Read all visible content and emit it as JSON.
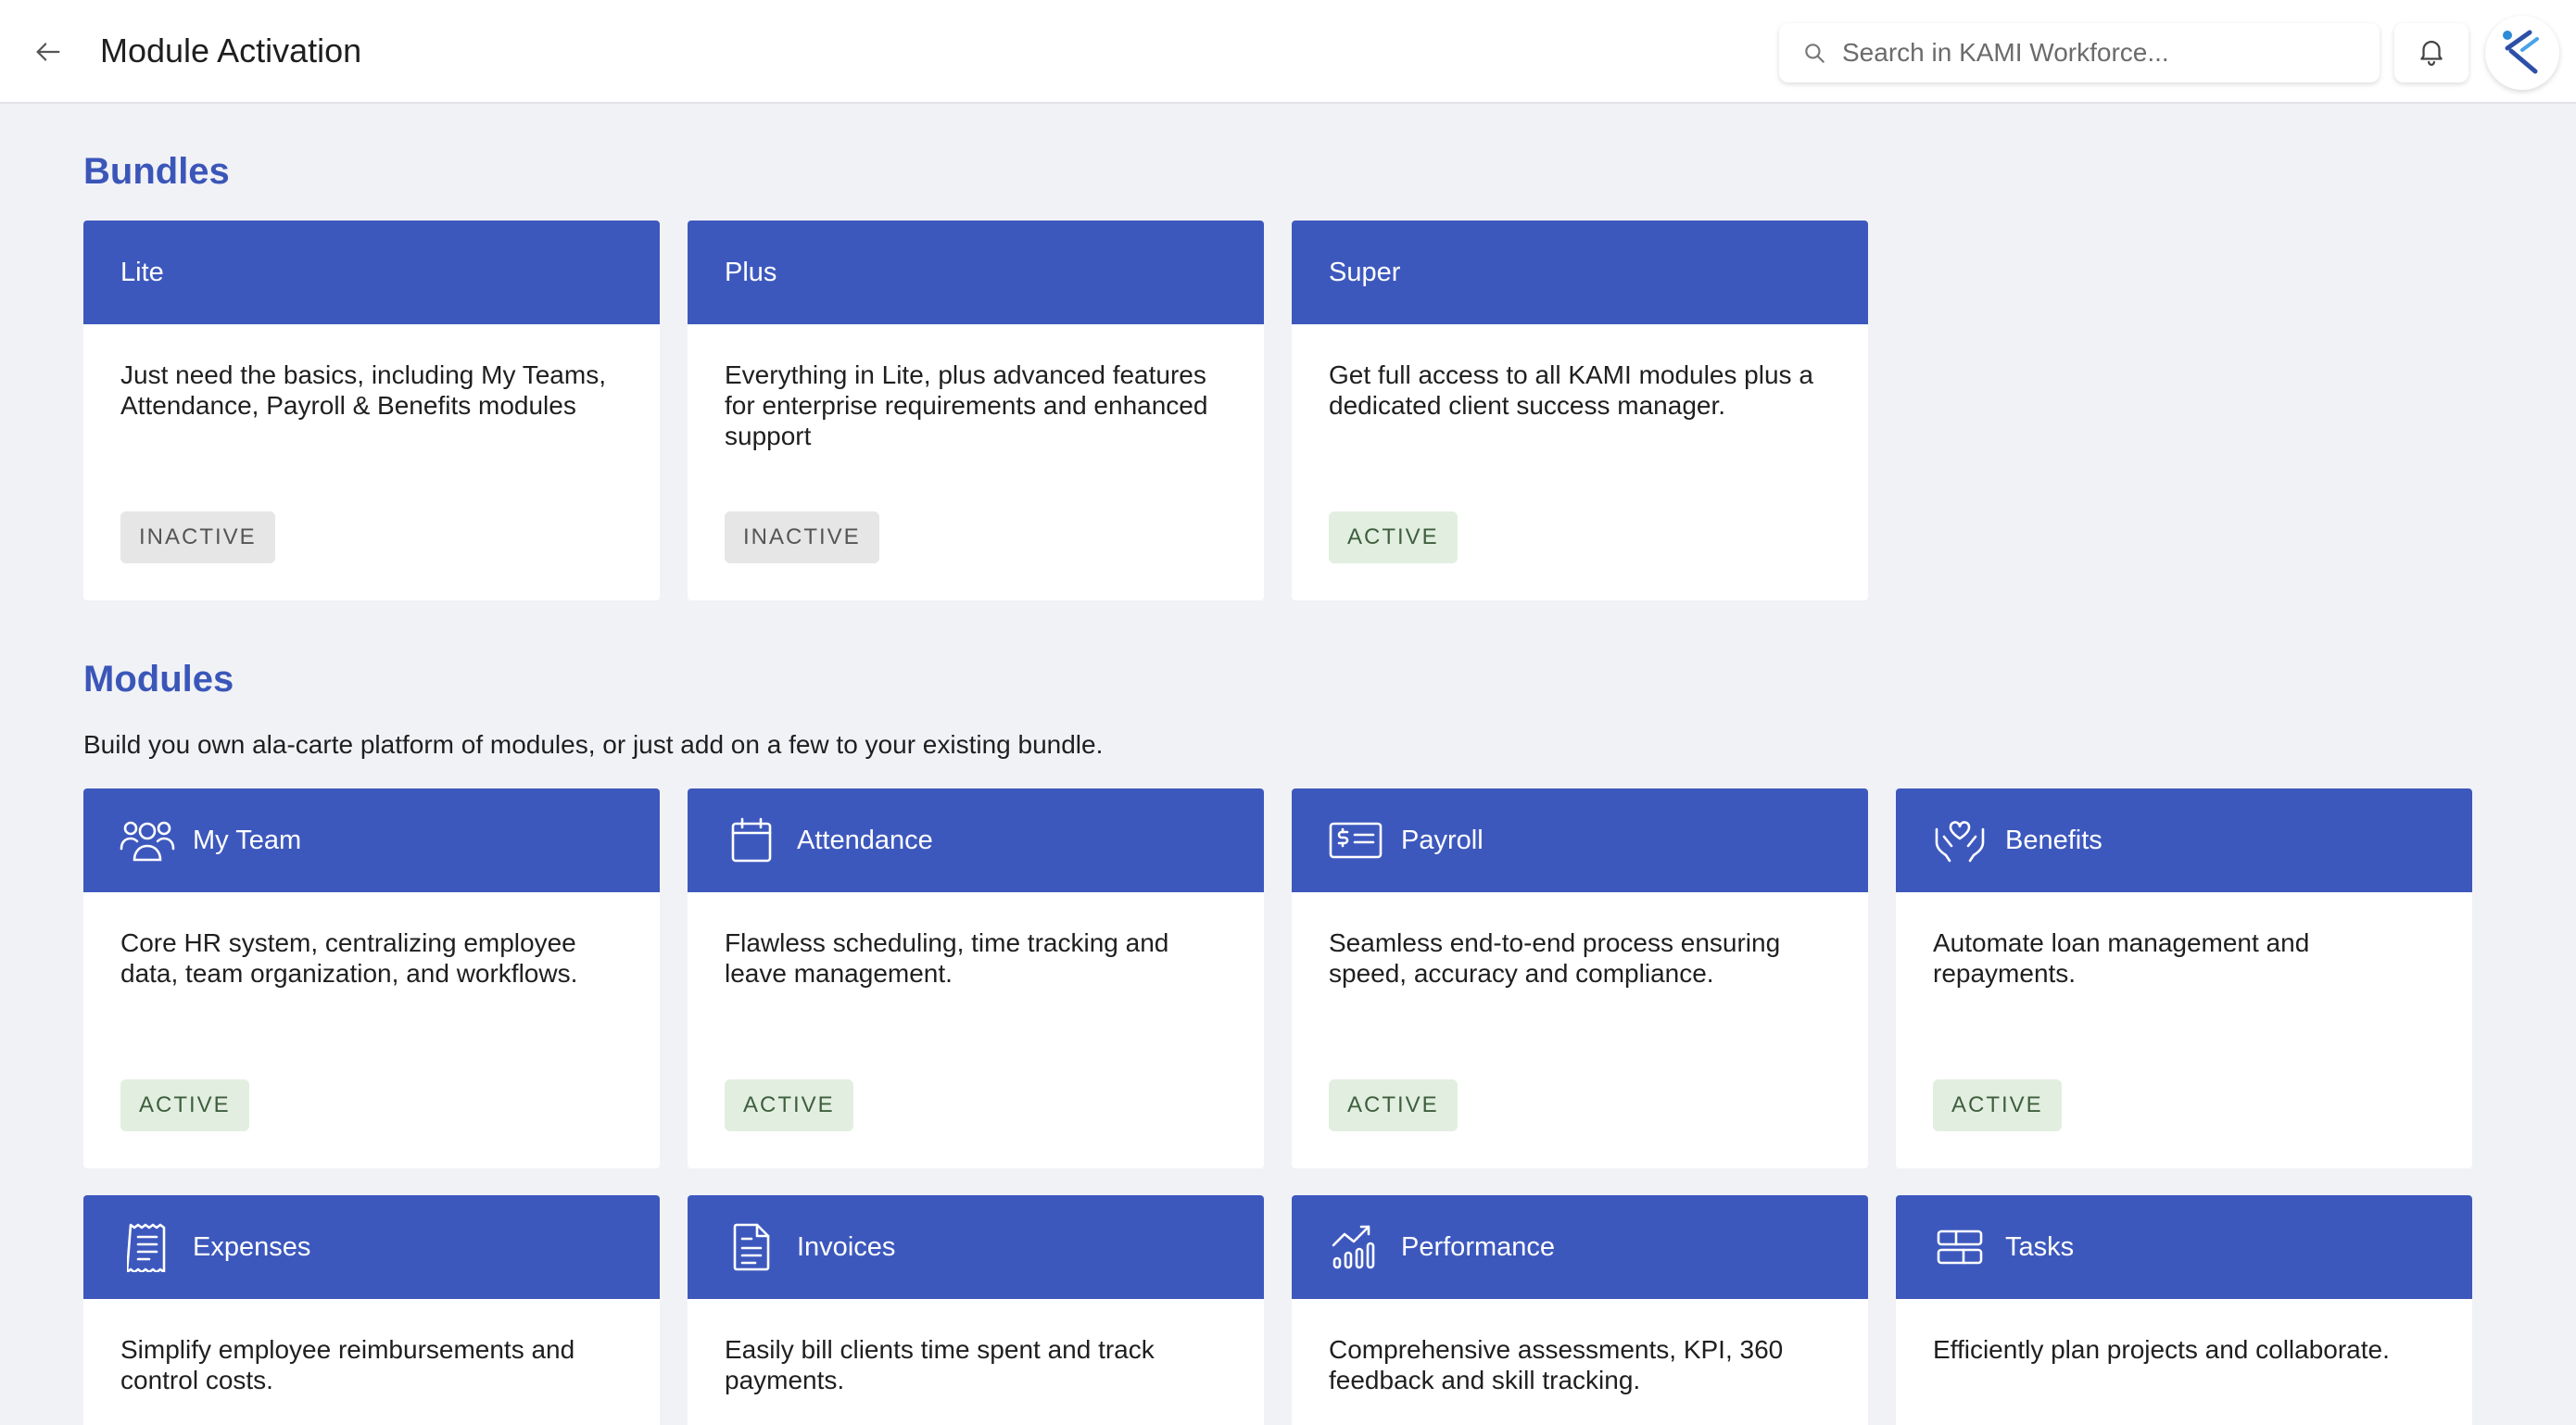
{
  "header": {
    "title": "Module Activation",
    "search_placeholder": "Search in KAMI Workforce..."
  },
  "bundles": {
    "heading": "Bundles",
    "items": [
      {
        "name": "Lite",
        "description": "Just need the basics, including My Teams, Attendance, Payroll & Benefits modules",
        "status": "INACTIVE"
      },
      {
        "name": "Plus",
        "description": "Everything in Lite, plus advanced features for enterprise requirements and enhanced support",
        "status": "INACTIVE"
      },
      {
        "name": "Super",
        "description": "Get full access to all KAMI modules plus a dedicated client success manager.",
        "status": "ACTIVE"
      }
    ]
  },
  "modules": {
    "heading": "Modules",
    "subtitle": "Build you own ala-carte platform of modules, or just add on a few to your existing bundle.",
    "items": [
      {
        "name": "My Team",
        "icon": "team-icon",
        "description": "Core HR system, centralizing employee data, team organization, and workflows.",
        "status": "ACTIVE"
      },
      {
        "name": "Attendance",
        "icon": "calendar-icon",
        "description": "Flawless scheduling, time tracking and leave management.",
        "status": "ACTIVE"
      },
      {
        "name": "Payroll",
        "icon": "payroll-icon",
        "description": "Seamless end-to-end process ensuring speed, accuracy and compliance.",
        "status": "ACTIVE"
      },
      {
        "name": "Benefits",
        "icon": "benefits-icon",
        "description": "Automate loan management and repayments.",
        "status": "ACTIVE"
      },
      {
        "name": "Expenses",
        "icon": "receipt-icon",
        "description": "Simplify employee reimbursements and control costs."
      },
      {
        "name": "Invoices",
        "icon": "invoice-icon",
        "description": "Easily bill clients time spent and track payments."
      },
      {
        "name": "Performance",
        "icon": "performance-icon",
        "description": "Comprehensive assessments, KPI, 360 feedback and skill tracking."
      },
      {
        "name": "Tasks",
        "icon": "tasks-icon",
        "description": "Efficiently plan projects and collaborate."
      }
    ]
  },
  "colors": {
    "accent": "#3d58bd",
    "heading": "#3b56b9",
    "active_badge_bg": "#e2efe0",
    "inactive_badge_bg": "#e6e6e6",
    "page_bg": "#f1f2f6"
  }
}
